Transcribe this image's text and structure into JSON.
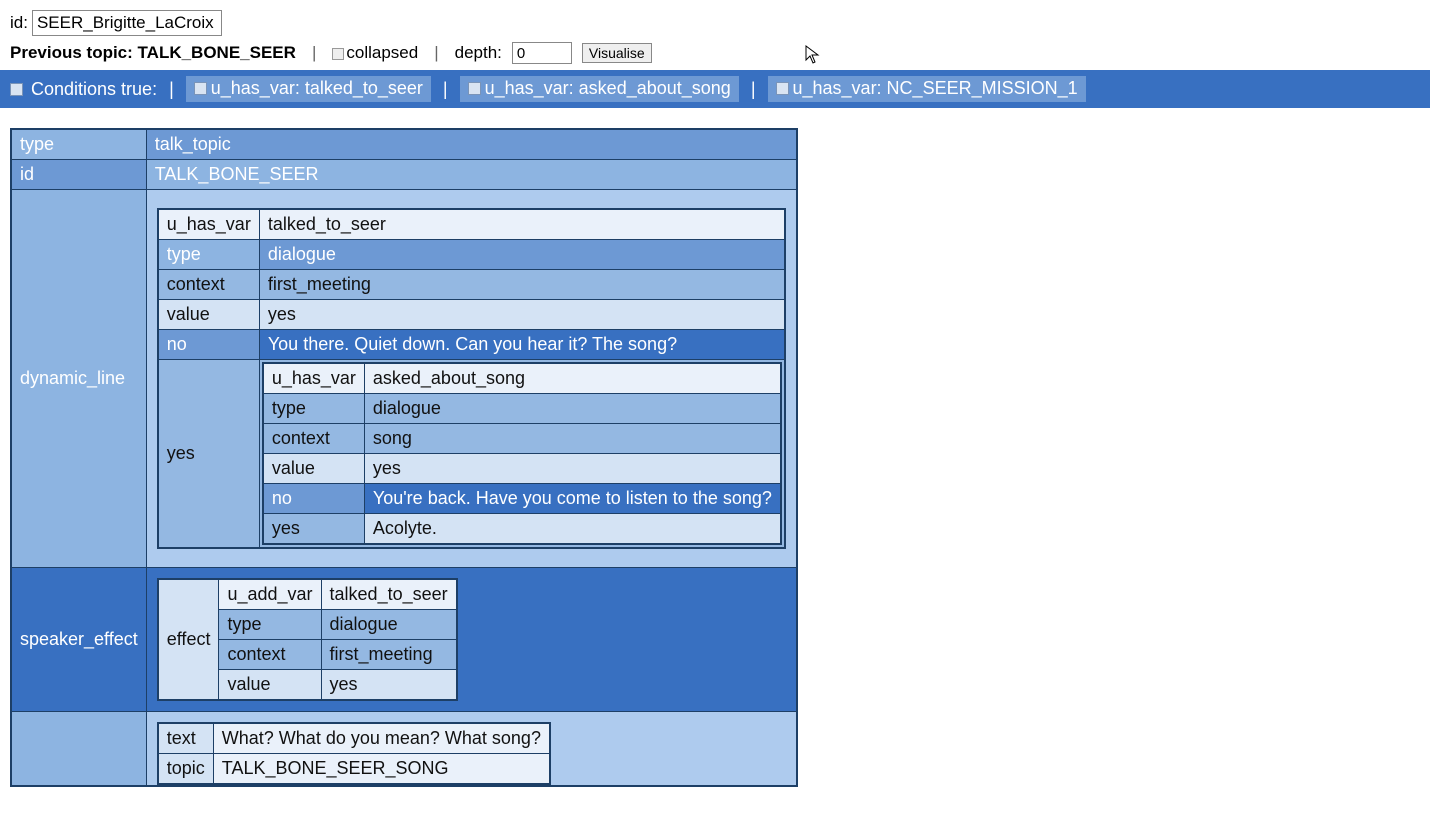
{
  "top": {
    "id_label": "id:",
    "id_value": "SEER_Brigitte_LaCroix",
    "prev_topic_label": "Previous topic:",
    "prev_topic_value": "TALK_BONE_SEER",
    "collapsed_label": "collapsed",
    "depth_label": "depth:",
    "depth_value": "0",
    "visualise_label": "Visualise"
  },
  "conditions": {
    "title": "Conditions true:",
    "items": [
      "u_has_var: talked_to_seer",
      "u_has_var: asked_about_song",
      "u_has_var: NC_SEER_MISSION_1"
    ]
  },
  "record": {
    "type_key": "type",
    "type_val": "talk_topic",
    "id_key": "id",
    "id_val": "TALK_BONE_SEER",
    "dynamic_line_key": "dynamic_line",
    "dl": {
      "u_has_var_key": "u_has_var",
      "u_has_var_val": "talked_to_seer",
      "type_key": "type",
      "type_val": "dialogue",
      "context_key": "context",
      "context_val": "first_meeting",
      "value_key": "value",
      "value_val": "yes",
      "no_key": "no",
      "no_val": "You there. Quiet down. Can you hear it? The song?",
      "yes_key": "yes",
      "inner": {
        "u_has_var_key": "u_has_var",
        "u_has_var_val": "asked_about_song",
        "type_key": "type",
        "type_val": "dialogue",
        "context_key": "context",
        "context_val": "song",
        "value_key": "value",
        "value_val": "yes",
        "no_key": "no",
        "no_val": "You're back. Have you come to listen to the song?",
        "yes_key": "yes",
        "yes_val": "Acolyte."
      }
    },
    "speaker_effect_key": "speaker_effect",
    "se": {
      "effect_key": "effect",
      "u_add_var_key": "u_add_var",
      "u_add_var_val": "talked_to_seer",
      "type_key": "type",
      "type_val": "dialogue",
      "context_key": "context",
      "context_val": "first_meeting",
      "value_key": "value",
      "value_val": "yes"
    },
    "response": {
      "text_key": "text",
      "text_val": "What? What do you mean? What song?",
      "topic_key": "topic",
      "topic_val": "TALK_BONE_SEER_SONG"
    }
  }
}
